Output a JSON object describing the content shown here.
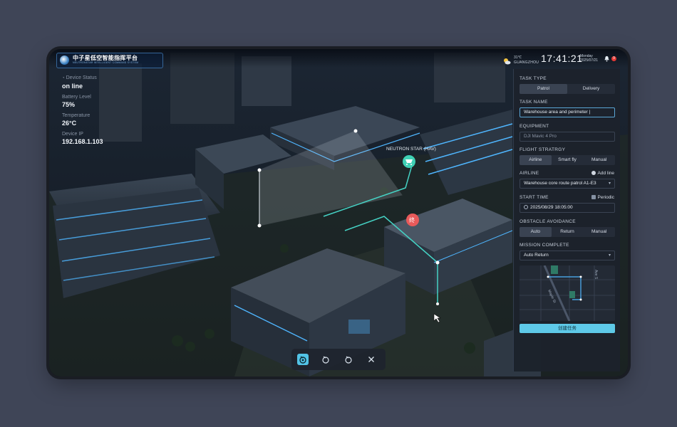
{
  "header": {
    "title": "中子星低空智能指挥平台",
    "subtitle": "NEUTRONSTAR INTELLIGENT COMMAND SYSTEM",
    "weather": {
      "temp": "31℃",
      "city": "GUANGZHOU",
      "icon": "partly-cloudy-icon"
    },
    "time": "17:41:21",
    "day": "Monday",
    "date": "2025/07/21",
    "notification_count": "9"
  },
  "device_info": {
    "status_label": "Device Status",
    "status_value": "on line",
    "battery_label": "Battery Level",
    "battery_value": "75%",
    "temp_label": "Temperature",
    "temp_value": "26°C",
    "ip_label": "Device IP",
    "ip_value": "192.168.1.103"
  },
  "scene": {
    "target_label": "NEUTRON STAR (HAV)",
    "end_marker": "终",
    "target_icon": "cart-icon"
  },
  "panel": {
    "task_type": {
      "label": "TASK TYPE",
      "options": [
        "Patrol",
        "Delivery"
      ],
      "selected": "Patrol"
    },
    "task_name": {
      "label": "TASK NAME",
      "value": "Warehouse area and perimeter |"
    },
    "equipment": {
      "label": "EQUIPMENT",
      "value": "DJI Mavic 4 Pro"
    },
    "flight_strategy": {
      "label": "FLIGHT STRATRGY",
      "options": [
        "Airline",
        "Smart fly",
        "Manual"
      ],
      "selected": "Airline"
    },
    "airline": {
      "label": "AIRLINE",
      "add_label": "Add line",
      "value": "Warehouse core route patrol A1-E3"
    },
    "start_time": {
      "label": "START TIME",
      "periodic_label": "Periodic",
      "value": "2025/08/29 18:05:00"
    },
    "obstacle": {
      "label": "OBSTACLE AVOIDANCE",
      "options": [
        "Auto",
        "Return",
        "Manual"
      ],
      "selected": "Auto"
    },
    "mission_complete": {
      "label": "MISSION COMPLETE",
      "value": "Auto Return"
    },
    "map_street_1": "Ave S",
    "map_street_2": "Maple St",
    "create_button": "创建任务"
  },
  "toolbar": {
    "icons": [
      "drone-icon",
      "drone-outline-icon",
      "drone-outline-icon",
      "close-icon"
    ]
  },
  "colors": {
    "accent": "#52c3e6",
    "panel_bg": "#1c222c",
    "alert": "#e53935"
  }
}
